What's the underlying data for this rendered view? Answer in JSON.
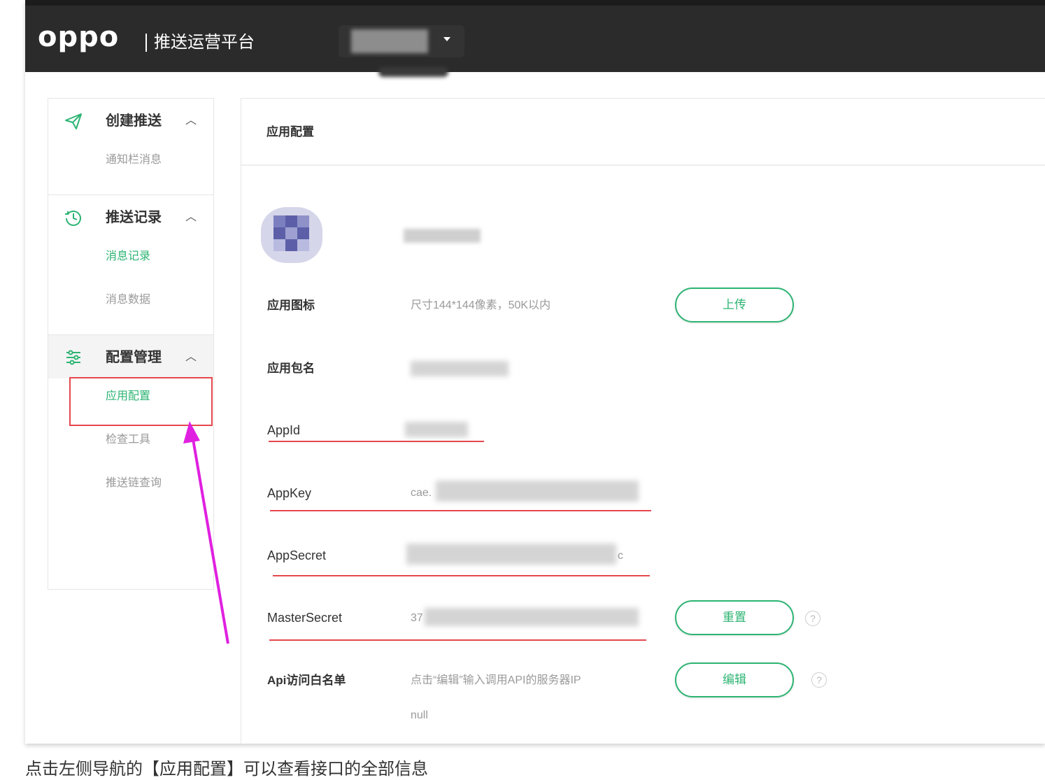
{
  "header": {
    "logo": "oppo",
    "platform_title": "推送运营平台"
  },
  "sidebar": {
    "groups": [
      {
        "title": "创建推送",
        "icon": "send-icon",
        "items": [
          {
            "label": "通知栏消息",
            "active": false
          }
        ]
      },
      {
        "title": "推送记录",
        "icon": "history-icon",
        "items": [
          {
            "label": "消息记录",
            "active": true
          },
          {
            "label": "消息数据",
            "active": false
          }
        ]
      },
      {
        "title": "配置管理",
        "icon": "settings-sliders-icon",
        "items": [
          {
            "label": "应用配置",
            "active": true
          },
          {
            "label": "检查工具",
            "active": false
          },
          {
            "label": "推送链查询",
            "active": false
          }
        ]
      }
    ]
  },
  "content": {
    "title": "应用配置",
    "rows": {
      "icon": {
        "label": "应用图标",
        "hint": "尺寸144*144像素，50K以内",
        "button": "上传"
      },
      "package": {
        "label": "应用包名"
      },
      "appid": {
        "label": "AppId"
      },
      "appkey": {
        "label": "AppKey",
        "prefix": "cae."
      },
      "appsecret": {
        "label": "AppSecret",
        "suffix": "c"
      },
      "mastersecret": {
        "label": "MasterSecret",
        "prefix": "37",
        "button": "重置",
        "help": "?"
      },
      "whitelist": {
        "label": "Api访问白名单",
        "hint": "点击“编辑”输入调用API的服务器IP",
        "value": "null",
        "button": "编辑",
        "help": "?"
      }
    }
  },
  "caption": "点击左侧导航的【应用配置】可以查看接口的全部信息",
  "colors": {
    "accent_green": "#2db473",
    "annotation_red": "#e5484d",
    "arrow_magenta": "#e020e0",
    "topbar": "#2b2b2b"
  }
}
